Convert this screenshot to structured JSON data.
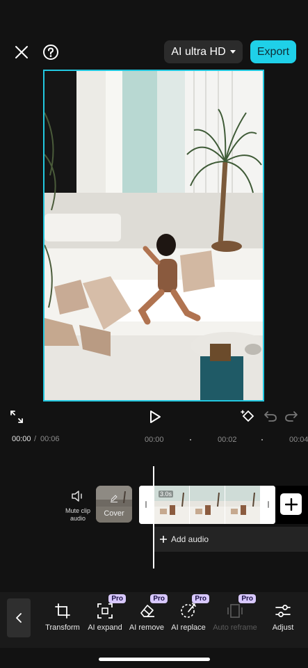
{
  "topbar": {
    "close_icon": "close-icon",
    "help_icon": "help-icon",
    "quality_label": "AI ultra HD",
    "export_label": "Export"
  },
  "playback": {
    "current_time": "00:00",
    "separator": "/",
    "total_time": "00:06"
  },
  "ruler": {
    "ticks": [
      "00:00",
      "00:02",
      "00:04"
    ]
  },
  "timeline": {
    "mute_label": "Mute clip audio",
    "cover_label": "Cover",
    "clip_duration": "3.0s",
    "add_audio_label": "Add audio"
  },
  "toolbar": {
    "items": [
      {
        "label": "Transform",
        "icon": "crop-icon",
        "pro": false,
        "enabled": true
      },
      {
        "label": "AI expand",
        "icon": "expand-icon",
        "pro": true,
        "enabled": true
      },
      {
        "label": "AI remove",
        "icon": "eraser-icon",
        "pro": true,
        "enabled": true
      },
      {
        "label": "AI replace",
        "icon": "replace-icon",
        "pro": true,
        "enabled": true
      },
      {
        "label": "Auto reframe",
        "icon": "reframe-icon",
        "pro": true,
        "enabled": false
      },
      {
        "label": "Adjust",
        "icon": "sliders-icon",
        "pro": false,
        "enabled": true
      }
    ],
    "pro_badge": "Pro"
  },
  "colors": {
    "accent": "#22c8e0",
    "export_bg": "#1fd0e8",
    "pro_badge": "#d8c8ff",
    "background": "#121212"
  }
}
